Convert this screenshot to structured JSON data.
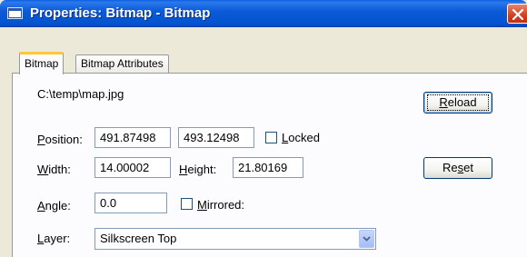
{
  "window": {
    "title": "Properties: Bitmap - Bitmap"
  },
  "tabs": [
    {
      "label": "Bitmap",
      "active": true
    },
    {
      "label": "Bitmap Attributes",
      "active": false
    }
  ],
  "bitmap": {
    "file_path": "C:\\temp\\map.jpg",
    "position_label_u": "P",
    "position_label_rest": "osition:",
    "position_x": "491.87498",
    "position_y": "493.12498",
    "locked_label_u": "L",
    "locked_label_rest": "ocked",
    "locked_checked": false,
    "width_label_u": "W",
    "width_label_rest": "idth:",
    "width_value": "14.00002",
    "height_label_u": "H",
    "height_label_rest": "eight:",
    "height_value": "21.80169",
    "angle_label_u": "A",
    "angle_label_rest": "ngle:",
    "angle_value": "0.0",
    "mirrored_label_u": "M",
    "mirrored_label_rest": "irrored:",
    "mirrored_checked": false,
    "layer_label_u": "L",
    "layer_label_rest": "ayer:",
    "layer_value": "Silkscreen Top"
  },
  "buttons": {
    "reload_u": "R",
    "reload_rest": "eload",
    "reset_pre": "Re",
    "reset_u": "s",
    "reset_rest": "et"
  },
  "colors": {
    "titlebar": "#0453cf",
    "close_button": "#d2401f",
    "tab_highlight": "#ffc83c",
    "dialog_background": "#ece9d8"
  }
}
